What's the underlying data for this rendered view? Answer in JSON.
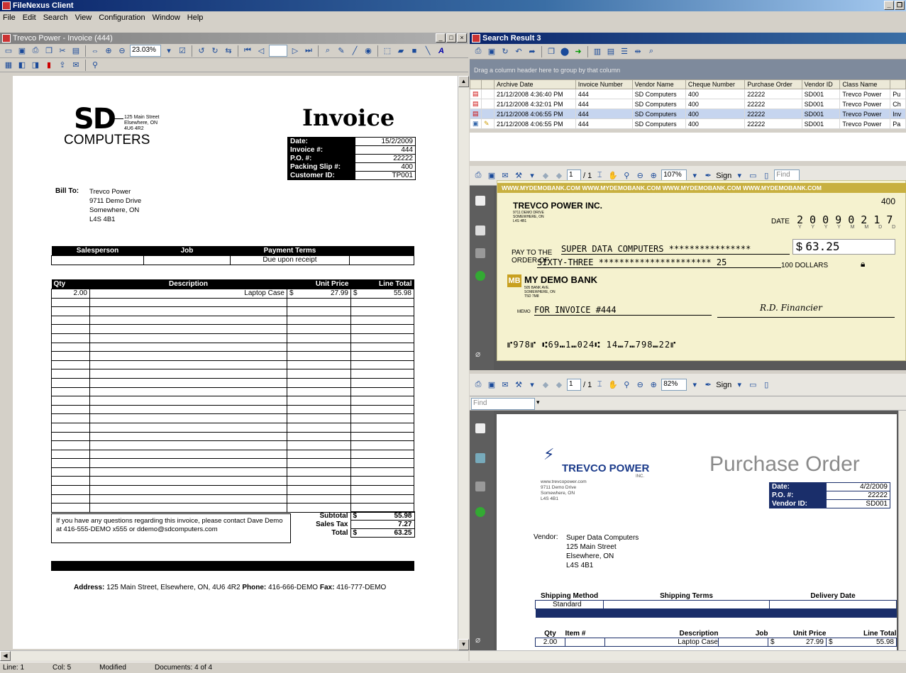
{
  "app": {
    "title": "FileNexus Client"
  },
  "menu": [
    "File",
    "Edit",
    "Search",
    "View",
    "Configuration",
    "Window",
    "Help"
  ],
  "left_pane": {
    "title": "Trevco Power - Invoice (444)",
    "zoom": "23.03%",
    "invoice": {
      "logo_top": "SD",
      "logo_bottom": "COMPUTERS",
      "addr1": "125 Main Street",
      "addr2": "Elsewhere, ON",
      "addr3": "4U6 4R2",
      "title": "Invoice",
      "info": [
        {
          "k": "Date:",
          "v": "15/2/2009"
        },
        {
          "k": "Invoice #:",
          "v": "444"
        },
        {
          "k": "P.O. #:",
          "v": "22222"
        },
        {
          "k": "Packing Slip #:",
          "v": "400"
        },
        {
          "k": "Customer ID:",
          "v": "TP001"
        }
      ],
      "bill_to_label": "Bill To:",
      "bill_to": [
        "Trevco Power",
        "9711 Demo Drive",
        "Somewhere, ON",
        "L4S 4B1"
      ],
      "terms_headers": [
        "Salesperson",
        "Job",
        "Payment Terms"
      ],
      "terms_value": "Due upon receipt",
      "item_headers": [
        "Qty",
        "Description",
        "Unit Price",
        "Line Total"
      ],
      "item": {
        "qty": "2.00",
        "desc": "Laptop Case",
        "cur1": "$",
        "price": "27.99",
        "cur2": "$",
        "total": "55.98"
      },
      "note": "If you have any questions regarding this invoice, please contact Dave Demo at 416-555-DEMO x555 or ddemo@sdcomputers.com",
      "subtotal_label": "Subtotal",
      "subtotal": "55.98",
      "tax_label": "Sales Tax",
      "tax": "7.27",
      "total_label": "Total",
      "total": "63.25",
      "currency": "$",
      "footer_address_label": "Address:",
      "footer_address": "125 Main Street, Elsewhere, ON, 4U6 4R2",
      "footer_phone_label": "Phone:",
      "footer_phone": "416-666-DEMO",
      "footer_fax_label": "Fax:",
      "footer_fax": "416-777-DEMO"
    }
  },
  "right_pane": {
    "title": "Search Result 3",
    "group_hint": "Drag a column header here to group by that column",
    "columns": [
      "Archive Date",
      "Invoice Number",
      "Vendor Name",
      "Cheque Number",
      "Purchase Order",
      "Vendor ID",
      "Class Name"
    ],
    "rows": [
      [
        "21/12/2008 4:36:40 PM",
        "444",
        "SD Computers",
        "400",
        "22222",
        "SD001",
        "Trevco Power",
        "Pu"
      ],
      [
        "21/12/2008 4:32:01 PM",
        "444",
        "SD Computers",
        "400",
        "22222",
        "SD001",
        "Trevco Power",
        "Ch"
      ],
      [
        "21/12/2008 4:06:55 PM",
        "444",
        "SD Computers",
        "400",
        "22222",
        "SD001",
        "Trevco Power",
        "Inv"
      ],
      [
        "21/12/2008 4:06:55 PM",
        "444",
        "SD Computers",
        "400",
        "22222",
        "SD001",
        "Trevco Power",
        "Pa"
      ]
    ]
  },
  "viewer1": {
    "page": "1",
    "pages": "/ 1",
    "zoom": "107%",
    "sign": "Sign",
    "find": "Find",
    "cheque": {
      "banner": "WWW.MYDEMOBANK.COM WWW.MYDEMOBANK.COM WWW.MYDEMOBANK.COM WWW.MYDEMOBANK.COM",
      "number": "400",
      "company": "TREVCO POWER INC.",
      "company_addr": "9711 DEMO DRIVE SOMEWHERE, ON L4S 4B1",
      "date_label": "DATE",
      "date": "2 0 0 9 0 2 1 7",
      "date_fmt": "Y Y Y Y M M D D",
      "pay_label1": "PAY TO THE",
      "pay_label2": "ORDER OF",
      "payee": "SUPER DATA COMPUTERS ****************",
      "amount_cur": "$",
      "amount": "63.25",
      "words": "SIXTY-THREE ********************** 25",
      "dollars": "100 DOLLARS",
      "bank_logo": "MB",
      "bank_name": "MY DEMO BANK",
      "bank_addr": "505 BANK AVE. SOMEWHERE, ON T5D 7M8",
      "memo_label": "MEMO",
      "memo": "FOR INVOICE #444",
      "signature": "R.D. Financier",
      "micr": "⑈978⑈ ⑆69⑉1⑉024⑆ 14⑉7⑉798⑉22⑈"
    }
  },
  "viewer2": {
    "page": "1",
    "pages": "/ 1",
    "zoom": "82%",
    "sign": "Sign",
    "find": "Find",
    "po": {
      "logo": "TREVCO POWER",
      "logo_sub": "INC.",
      "web": "www.trevcopower.com",
      "addr1": "9711 Demo Drive",
      "addr2": "Somewhere, ON",
      "addr3": "L4S 4B1",
      "title": "Purchase Order",
      "info": [
        {
          "k": "Date:",
          "v": "4/2/2009"
        },
        {
          "k": "P.O. #:",
          "v": "22222"
        },
        {
          "k": "Vendor ID:",
          "v": "SD001"
        }
      ],
      "vendor_label": "Vendor:",
      "vendor": [
        "Super Data Computers",
        "125 Main Street",
        "Elsewhere, ON",
        "L4S 4B1"
      ],
      "ship_headers": [
        "Shipping Method",
        "Shipping Terms",
        "Delivery Date"
      ],
      "ship_method": "Standard",
      "item_headers": [
        "Qty",
        "Item #",
        "Description",
        "Job",
        "Unit Price",
        "Line Total"
      ],
      "item": {
        "qty": "2.00",
        "desc": "Laptop Case",
        "cur1": "$",
        "price": "27.99",
        "cur2": "$",
        "total": "55.98"
      }
    }
  },
  "status": {
    "line": "Line:  1",
    "col": "Col:  5",
    "modified": "Modified",
    "documents": "Documents: 4 of 4"
  }
}
